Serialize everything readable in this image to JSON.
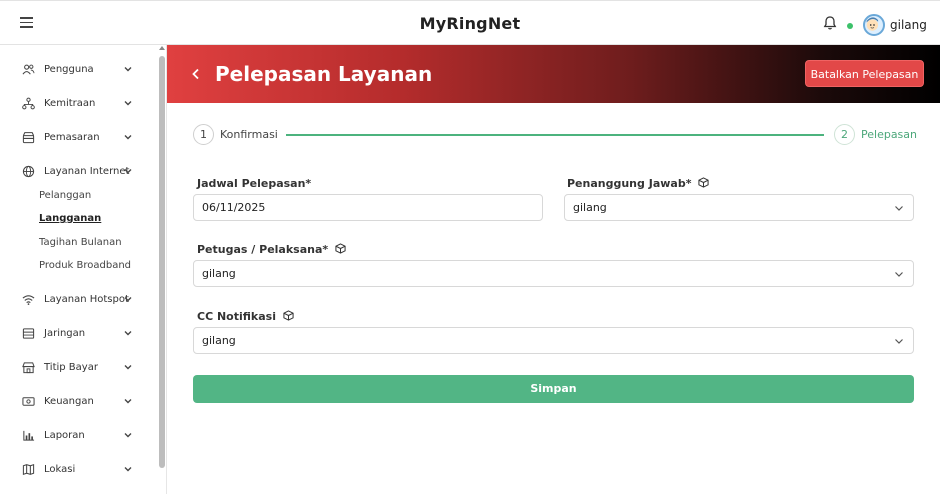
{
  "header": {
    "app_title": "MyRingNet",
    "username": "gilang"
  },
  "sidebar": {
    "items": [
      {
        "label": "Pengguna",
        "icon": "users-icon"
      },
      {
        "label": "Kemitraan",
        "icon": "network-icon"
      },
      {
        "label": "Pemasaran",
        "icon": "store-icon"
      },
      {
        "label": "Layanan Internet",
        "icon": "globe-icon"
      },
      {
        "label": "Layanan Hotspot",
        "icon": "wifi-icon"
      },
      {
        "label": "Jaringan",
        "icon": "server-icon"
      },
      {
        "label": "Titip Bayar",
        "icon": "shop-icon"
      },
      {
        "label": "Keuangan",
        "icon": "money-icon"
      },
      {
        "label": "Laporan",
        "icon": "bar-chart-icon"
      },
      {
        "label": "Lokasi",
        "icon": "map-icon"
      }
    ],
    "subitems": [
      "Pelanggan",
      "Langganan",
      "Tagihan Bulanan",
      "Produk Broadband"
    ]
  },
  "banner": {
    "title": "Pelepasan Layanan",
    "cancel_label": "Batalkan Pelepasan"
  },
  "stepper": {
    "step1": {
      "num": "1",
      "label": "Konfirmasi"
    },
    "step2": {
      "num": "2",
      "label": "Pelepasan"
    }
  },
  "form": {
    "jadwal": {
      "label": "Jadwal Pelepasan*",
      "value": "06/11/2025"
    },
    "penanggung": {
      "label": "Penanggung Jawab*",
      "value": "gilang"
    },
    "petugas": {
      "label": "Petugas / Pelaksana*",
      "value": "gilang"
    },
    "cc": {
      "label": "CC Notifikasi",
      "value": "gilang"
    },
    "save_label": "Simpan"
  },
  "colors": {
    "accent_green": "#52b585",
    "danger_red": "#e24848"
  }
}
